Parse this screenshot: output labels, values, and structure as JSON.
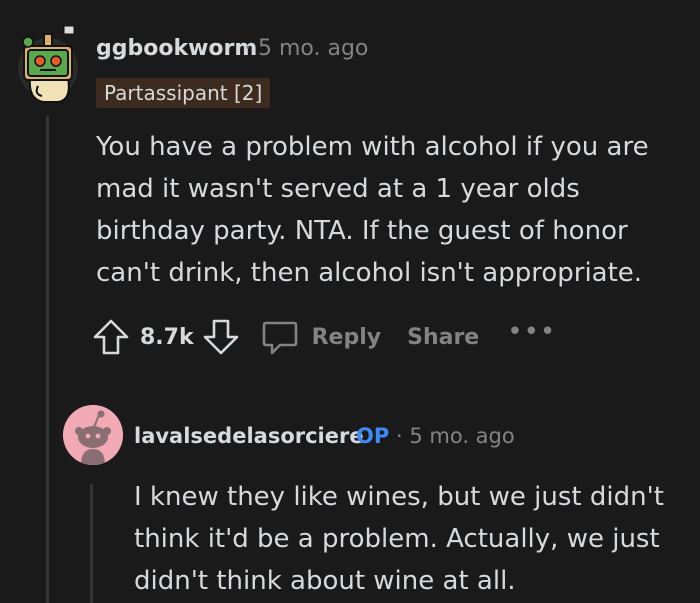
{
  "comment": {
    "author": "ggbookworm",
    "meta": "· 5 mo. ago",
    "flair": "Partassipant [2]",
    "body": "You have a problem with alcohol if you are mad it wasn't served at a 1 year olds birthday party. NTA. If the guest of honor can't drink, then alcohol isn't appropriate.",
    "score": "8.7k",
    "reply_label": "Reply",
    "share_label": "Share",
    "more_label": "•••"
  },
  "reply": {
    "author": "lavalsedelasorciere",
    "op_badge": "OP",
    "meta": "· 5 mo. ago",
    "body": "I knew they like wines, but we just didn't think it'd be a problem. Actually, we just didn't think about wine at all."
  },
  "icons": {
    "upvote": "arrow-up-icon",
    "downvote": "arrow-down-icon",
    "reply": "speech-bubble-icon",
    "more": "more-dots-icon"
  },
  "colors": {
    "background": "#1a1a1b",
    "text": "#d7dadc",
    "muted": "#818384",
    "op": "#3d8af7",
    "flair_bg": "#3d2b1f",
    "avatar2_bg": "#f2a9b6"
  }
}
